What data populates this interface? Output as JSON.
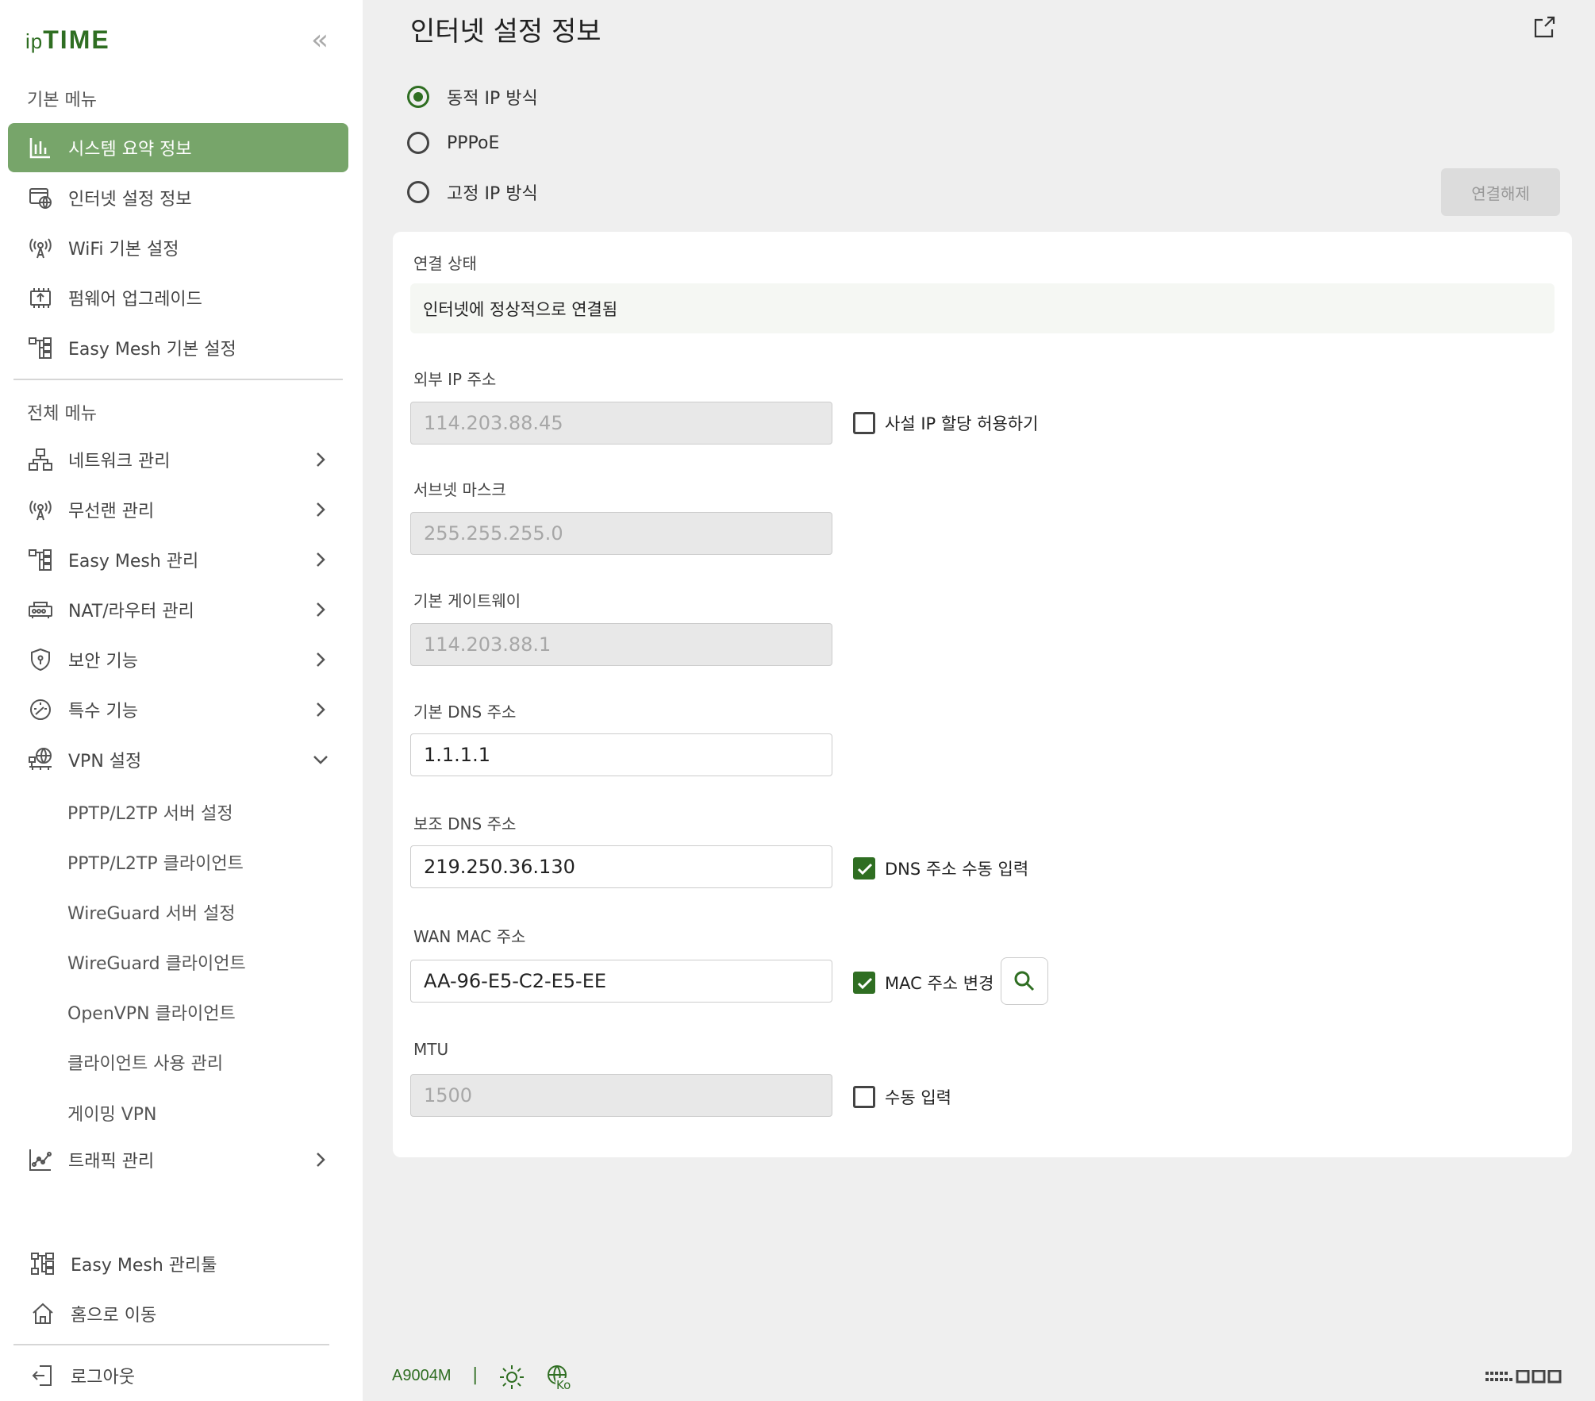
{
  "brand": {
    "logo_ip": "ip",
    "logo_time": "TIME",
    "accent": "#2f6e22",
    "active_bg": "#77a56a"
  },
  "sidebar": {
    "collapse_glyph": "«",
    "basic_title": "기본 메뉴",
    "basic_items": [
      {
        "label": "시스템 요약 정보",
        "icon": "bar-chart-icon",
        "active": true
      },
      {
        "label": "인터넷 설정 정보",
        "icon": "internet-icon"
      },
      {
        "label": "WiFi 기본 설정",
        "icon": "wifi-antenna-icon"
      },
      {
        "label": "펌웨어 업그레이드",
        "icon": "firmware-icon"
      },
      {
        "label": "Easy Mesh 기본 설정",
        "icon": "mesh-icon"
      }
    ],
    "all_title": "전체 메뉴",
    "all_items": [
      {
        "label": "네트워크 관리",
        "icon": "network-icon"
      },
      {
        "label": "무선랜 관리",
        "icon": "wireless-icon"
      },
      {
        "label": "Easy Mesh 관리",
        "icon": "mesh-icon"
      },
      {
        "label": "NAT/라우터 관리",
        "icon": "router-icon"
      },
      {
        "label": "보안 기능",
        "icon": "shield-icon"
      },
      {
        "label": "특수 기능",
        "icon": "gauge-icon"
      },
      {
        "label": "VPN 설정",
        "icon": "vpn-globe-icon",
        "expanded": true
      }
    ],
    "vpn_sub": [
      "PPTP/L2TP 서버 설정",
      "PPTP/L2TP 클라이언트",
      "WireGuard 서버 설정",
      "WireGuard 클라이언트",
      "OpenVPN 클라이언트",
      "클라이언트 사용 관리",
      "게이밍 VPN"
    ],
    "traffic": {
      "label": "트래픽 관리",
      "icon": "traffic-chart-icon"
    },
    "bottom": [
      {
        "label": "Easy Mesh 관리툴",
        "icon": "mesh-tool-icon"
      },
      {
        "label": "홈으로 이동",
        "icon": "home-icon"
      },
      {
        "label": "로그아웃",
        "icon": "logout-icon"
      }
    ]
  },
  "main": {
    "title": "인터넷 설정 정보",
    "modes": [
      {
        "label": "동적 IP 방식",
        "selected": true
      },
      {
        "label": "PPPoE",
        "selected": false
      },
      {
        "label": "고정 IP 방식",
        "selected": false
      }
    ],
    "disconnect_label": "연결해제",
    "status_label": "연결 상태",
    "status_text": "인터넷에 정상적으로 연결됨",
    "ext_ip_label": "외부 IP 주소",
    "ext_ip": "114.203.88.45",
    "private_ip_label": "사설 IP 할당 허용하기",
    "subnet_label": "서브넷 마스크",
    "subnet": "255.255.255.0",
    "gateway_label": "기본 게이트웨이",
    "gateway": "114.203.88.1",
    "dns1_label": "기본 DNS 주소",
    "dns1": "1.1.1.1",
    "dns2_label": "보조 DNS 주소",
    "dns2": "219.250.36.130",
    "dns_manual_label": "DNS 주소 수동 입력",
    "mac_label": "WAN MAC 주소",
    "mac": "AA-96-E5-C2-E5-EE",
    "mac_change_label": "MAC 주소 변경",
    "mtu_label": "MTU",
    "mtu": "1500",
    "mtu_manual_label": "수동 입력"
  },
  "footer": {
    "model": "A9004M",
    "separator": "|",
    "lang_code": "Ko"
  }
}
